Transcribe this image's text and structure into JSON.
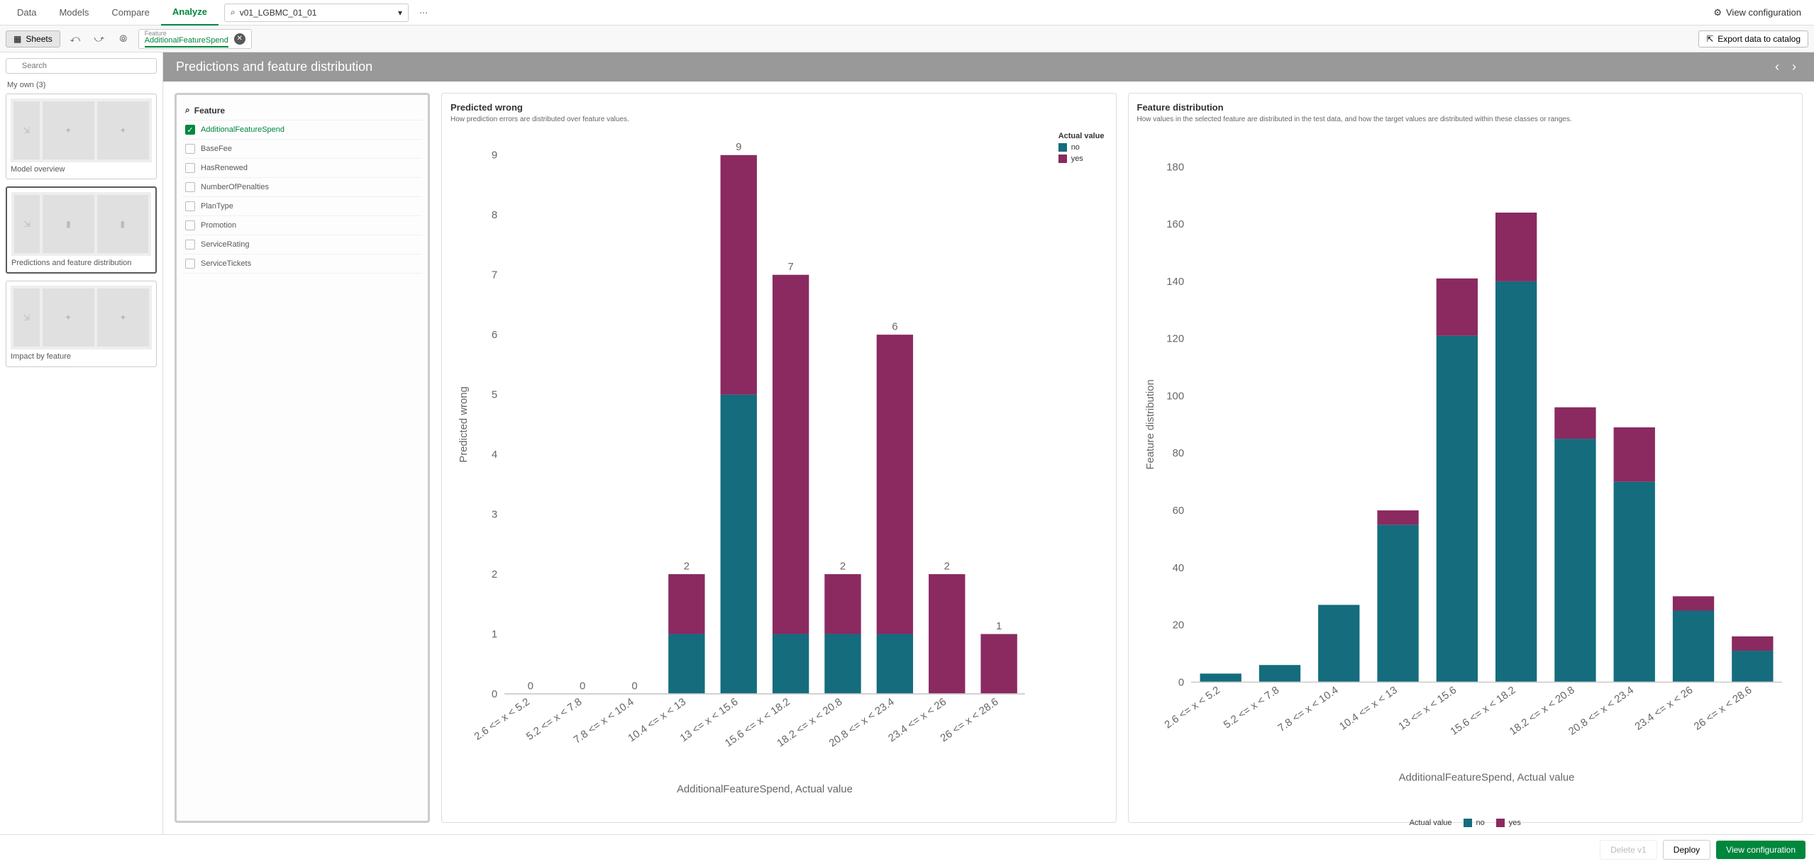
{
  "nav": {
    "tabs": [
      "Data",
      "Models",
      "Compare",
      "Analyze"
    ],
    "active": "Analyze",
    "model_dropdown": "v01_LGBMC_01_01",
    "view_config": "View configuration"
  },
  "subbar": {
    "sheets_btn": "Sheets",
    "feature_chip": {
      "label": "Feature",
      "value": "AdditionalFeatureSpend"
    },
    "export_btn": "Export data to catalog"
  },
  "sidebar": {
    "search_placeholder": "Search",
    "section": "My own (3)",
    "sheets": [
      {
        "title": "Model overview",
        "active": false
      },
      {
        "title": "Predictions and feature distribution",
        "active": true
      },
      {
        "title": "Impact by feature",
        "active": false
      }
    ]
  },
  "sheet_header": "Predictions and feature distribution",
  "feature_panel": {
    "header": "Feature",
    "items": [
      {
        "name": "AdditionalFeatureSpend",
        "checked": true
      },
      {
        "name": "BaseFee",
        "checked": false
      },
      {
        "name": "HasRenewed",
        "checked": false
      },
      {
        "name": "NumberOfPenalties",
        "checked": false
      },
      {
        "name": "PlanType",
        "checked": false
      },
      {
        "name": "Promotion",
        "checked": false
      },
      {
        "name": "ServiceRating",
        "checked": false
      },
      {
        "name": "ServiceTickets",
        "checked": false
      }
    ]
  },
  "chart1": {
    "title": "Predicted wrong",
    "subtitle": "How prediction errors are distributed over feature values.",
    "legend_title": "Actual value",
    "xlabel": "AdditionalFeatureSpend, Actual value",
    "ylabel": "Predicted wrong"
  },
  "chart2": {
    "title": "Feature distribution",
    "subtitle": "How values in the selected feature are distributed in the test data, and how the target values are distributed within these classes or ranges.",
    "legend_title": "Actual value",
    "xlabel": "AdditionalFeatureSpend, Actual value",
    "ylabel": "Feature distribution"
  },
  "footer": {
    "delete": "Delete v1",
    "deploy": "Deploy",
    "view": "View configuration"
  },
  "chart_data": [
    {
      "type": "bar",
      "title": "Predicted wrong",
      "xlabel": "AdditionalFeatureSpend, Actual value",
      "ylabel": "Predicted wrong",
      "ylim": [
        0,
        9
      ],
      "legend_title": "Actual value",
      "categories": [
        "2.6 <= x < 5.2",
        "5.2 <= x < 7.8",
        "7.8 <= x < 10.4",
        "10.4 <= x < 13",
        "13 <= x < 15.6",
        "15.6 <= x < 18.2",
        "18.2 <= x < 20.8",
        "20.8 <= x < 23.4",
        "23.4 <= x < 26",
        "26 <= x < 28.6"
      ],
      "series": [
        {
          "name": "no",
          "values": [
            0,
            0,
            0,
            1,
            5,
            1,
            1,
            1,
            0,
            0
          ]
        },
        {
          "name": "yes",
          "values": [
            0,
            0,
            0,
            1,
            4,
            6,
            1,
            5,
            2,
            1
          ]
        }
      ],
      "totals": [
        0,
        0,
        0,
        2,
        9,
        7,
        2,
        6,
        2,
        1
      ]
    },
    {
      "type": "bar",
      "title": "Feature distribution",
      "xlabel": "AdditionalFeatureSpend, Actual value",
      "ylabel": "Feature distribution",
      "ylim": [
        0,
        180
      ],
      "legend_title": "Actual value",
      "categories": [
        "2.6 <= x < 5.2",
        "5.2 <= x < 7.8",
        "7.8 <= x < 10.4",
        "10.4 <= x < 13",
        "13 <= x < 15.6",
        "15.6 <= x < 18.2",
        "18.2 <= x < 20.8",
        "20.8 <= x < 23.4",
        "23.4 <= x < 26",
        "26 <= x < 28.6"
      ],
      "series": [
        {
          "name": "no",
          "values": [
            3,
            6,
            27,
            55,
            121,
            140,
            85,
            70,
            25,
            11
          ]
        },
        {
          "name": "yes",
          "values": [
            0,
            0,
            0,
            5,
            20,
            24,
            11,
            19,
            5,
            5
          ]
        }
      ],
      "totals_approx": [
        3,
        6,
        27,
        60,
        141,
        164,
        96,
        89,
        30,
        16
      ]
    }
  ]
}
